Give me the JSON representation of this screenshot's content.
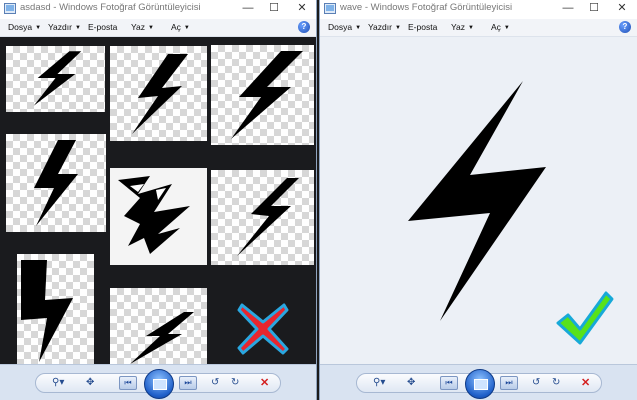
{
  "left_window": {
    "title": "asdasd - Windows Fotoğraf Görüntüleyicisi",
    "menu": [
      "Dosya",
      "Yazdır",
      "E-posta",
      "Yaz",
      "Aç"
    ]
  },
  "right_window": {
    "title": "wave - Windows Fotoğraf Görüntüleyicisi",
    "menu": [
      "Dosya",
      "Yazdır",
      "E-posta",
      "Yaz",
      "Aç"
    ]
  },
  "window_controls": {
    "minimize": "—",
    "maximize": "☐",
    "close": "✕"
  },
  "help_label": "?",
  "toolbar": {
    "zoom_icon": "magnifier-icon",
    "fit_icon": "actual-size-icon",
    "prev_icon": "previous-icon",
    "slideshow_icon": "slideshow-icon",
    "next_icon": "next-icon",
    "rotate_ccw_icon": "rotate-ccw-icon",
    "rotate_cw_icon": "rotate-cw-icon",
    "delete_icon": "delete-icon"
  },
  "colors": {
    "left_background": "#1a1b1e",
    "right_background": "#ecf0f6",
    "cross_mark": "#e8262e",
    "check_mark": "#58e21a"
  }
}
